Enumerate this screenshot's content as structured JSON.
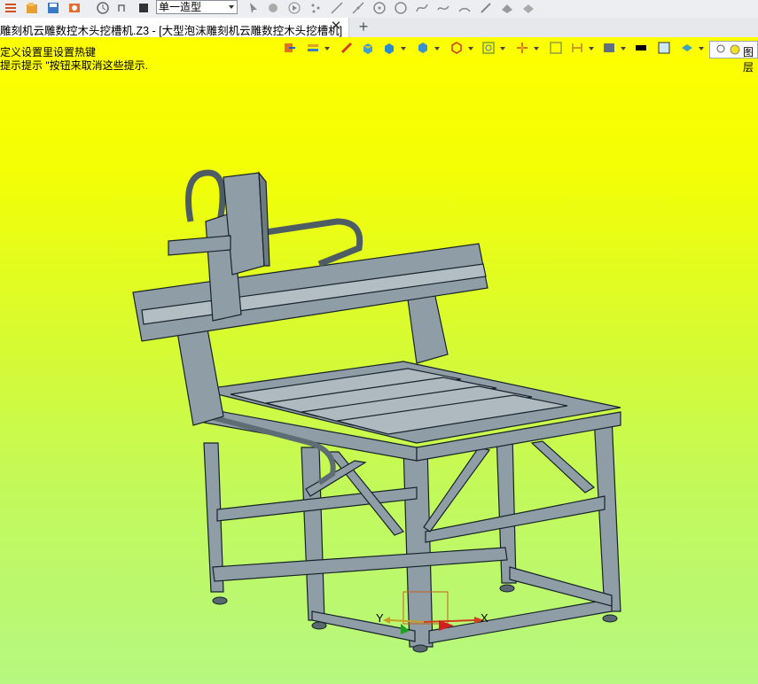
{
  "toolbar": {
    "mode_select": "单一造型",
    "icons": [
      "menu-icon",
      "open-file-icon",
      "save-icon",
      "import-icon",
      "history-icon",
      "undo-redo-icon",
      "stop-icon",
      "pointer-icon",
      "select-icon",
      "run-icon",
      "points-icon",
      "line-icon",
      "segment-icon",
      "circle-center-icon",
      "circle-icon",
      "spline-icon",
      "curve-icon",
      "arc-icon",
      "pen-icon",
      "shape-icon",
      "fillet-icon"
    ]
  },
  "tab": {
    "label": "雕刻机云雕数控木头挖槽机.Z3 - [大型泡沫雕刻机云雕数控木头挖槽机]",
    "close": "✕",
    "add": "+"
  },
  "hints": {
    "line1": "定义设置里设置热键",
    "line2": "提示提示 \"按钮来取消这些提示."
  },
  "view_toolbar": {
    "icons": [
      "exit-icon",
      "layers-icon",
      "measure-icon",
      "box-icon",
      "solid-icon",
      "view-cube-icon",
      "section-icon",
      "zoom-fit-icon",
      "orient-icon",
      "frame-icon",
      "dimension-icon",
      "display-mode-icon",
      "black-swatch-icon",
      "light-swatch-icon",
      "layer-display-icon"
    ],
    "legend_label": "图层"
  },
  "triad": {
    "x_label": "X",
    "y_label": "Y"
  },
  "colors": {
    "viewport_top": "#ffff00",
    "viewport_bottom": "#b6f880",
    "model": "#8f9ea6",
    "model_edge": "#17222a"
  }
}
